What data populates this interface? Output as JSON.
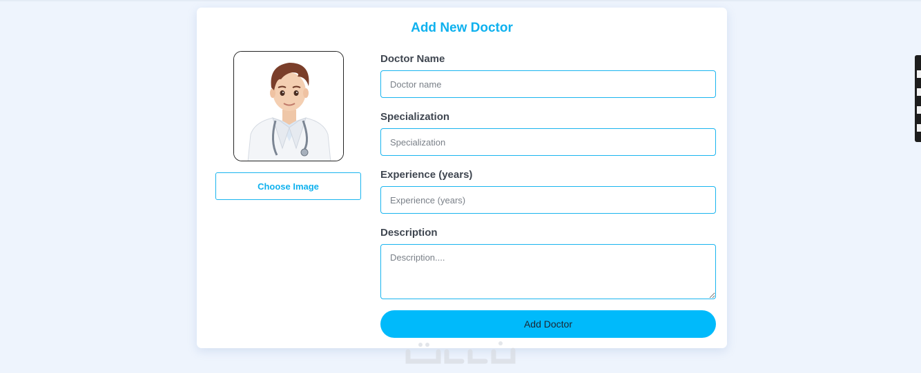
{
  "form": {
    "title": "Add New Doctor",
    "choose_image_label": "Choose Image",
    "fields": [
      {
        "label": "Doctor Name",
        "placeholder": "Doctor name"
      },
      {
        "label": "Specialization",
        "placeholder": "Specialization"
      },
      {
        "label": "Experience (years)",
        "placeholder": "Experience (years)"
      },
      {
        "label": "Description",
        "placeholder": "Description...."
      }
    ],
    "submit_label": "Add Doctor"
  },
  "colors": {
    "accent": "#0fb1ee",
    "button": "#00bafb",
    "background": "#eef4fd"
  },
  "icons": {
    "avatar": "doctor-avatar-illustration",
    "watermark": "site-watermark-logo"
  }
}
